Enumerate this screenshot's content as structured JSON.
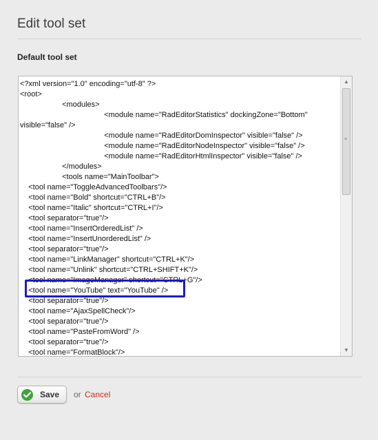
{
  "page": {
    "title": "Edit tool set",
    "section_label": "Default tool set"
  },
  "editor": {
    "lines": [
      "<?xml version=\"1.0\" encoding=\"utf-8\" ?>",
      "<root>",
      "                    <modules>",
      "                                        <module name=\"RadEditorStatistics\" dockingZone=\"Bottom\"",
      "visible=\"false\" />",
      "                                        <module name=\"RadEditorDomInspector\" visible=\"false\" />",
      "                                        <module name=\"RadEditorNodeInspector\" visible=\"false\" />",
      "                                        <module name=\"RadEditorHtmlInspector\" visible=\"false\" />",
      "                    </modules>",
      "                    <tools name=\"MainToolbar\">",
      "    <tool name=\"ToggleAdvancedToolbars\"/>",
      "    <tool name=\"Bold\" shortcut=\"CTRL+B\"/>",
      "    <tool name=\"Italic\" shortcut=\"CTRL+I\"/>",
      "    <tool separator=\"true\"/>",
      "    <tool name=\"InsertOrderedList\" />",
      "    <tool name=\"InsertUnorderedList\" />",
      "    <tool separator=\"true\"/>",
      "    <tool name=\"LinkManager\" shortcut=\"CTRL+K\"/>",
      "    <tool name=\"Unlink\" shortcut=\"CTRL+SHIFT+K\"/>",
      "    <tool name=\"ImageManager\" shortcut=\"CTRL+G\"/>",
      "    <tool name=\"YouTube\" text=\"YouTube\" />",
      "    <tool separator=\"true\"/>",
      "    <tool name=\"AjaxSpellCheck\"/>",
      "    <tool separator=\"true\"/>",
      "    <tool name=\"PasteFromWord\" />",
      "    <tool separator=\"true\"/>",
      "    <tool name=\"FormatBlock\"/>"
    ]
  },
  "actions": {
    "save_label": "Save",
    "or_text": "or",
    "cancel_label": "Cancel"
  },
  "colors": {
    "highlight_border": "#1a1acf",
    "cancel_link": "#d0281c",
    "save_icon": "#3fa33a"
  }
}
